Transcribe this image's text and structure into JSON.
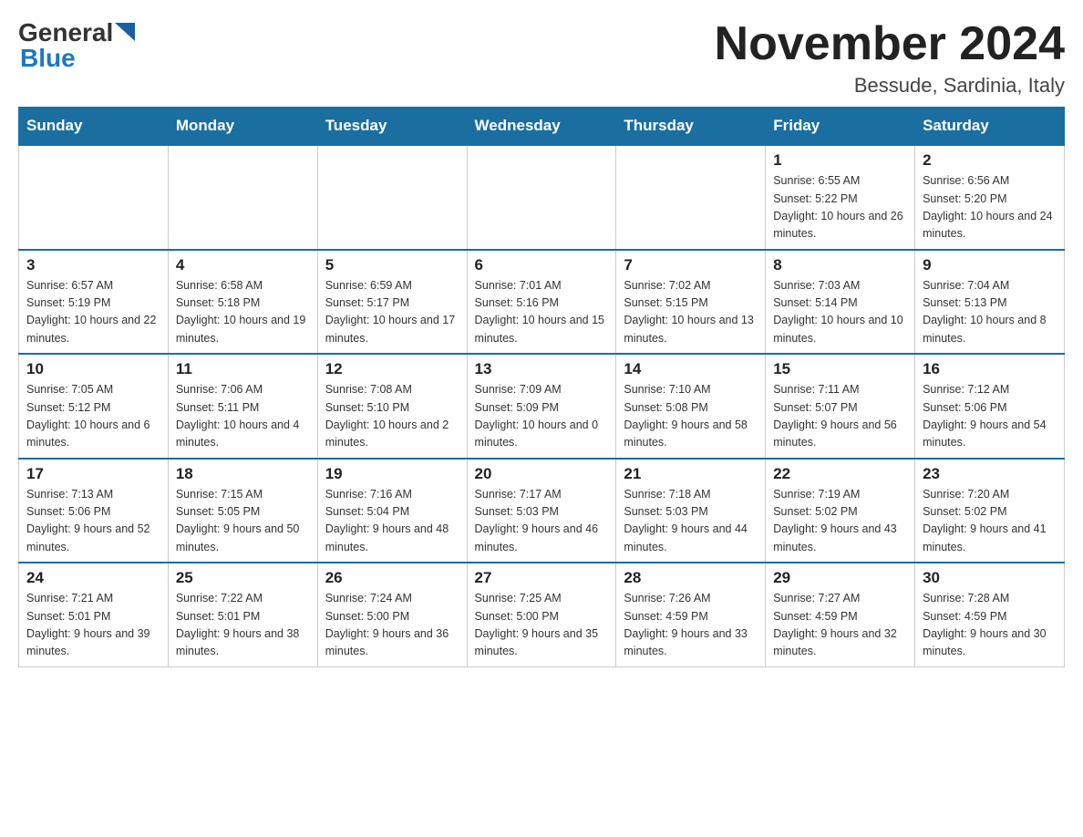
{
  "header": {
    "logo_general": "General",
    "logo_blue": "Blue",
    "title": "November 2024",
    "subtitle": "Bessude, Sardinia, Italy"
  },
  "weekdays": [
    "Sunday",
    "Monday",
    "Tuesday",
    "Wednesday",
    "Thursday",
    "Friday",
    "Saturday"
  ],
  "weeks": [
    [
      {
        "day": "",
        "info": ""
      },
      {
        "day": "",
        "info": ""
      },
      {
        "day": "",
        "info": ""
      },
      {
        "day": "",
        "info": ""
      },
      {
        "day": "",
        "info": ""
      },
      {
        "day": "1",
        "info": "Sunrise: 6:55 AM\nSunset: 5:22 PM\nDaylight: 10 hours and 26 minutes."
      },
      {
        "day": "2",
        "info": "Sunrise: 6:56 AM\nSunset: 5:20 PM\nDaylight: 10 hours and 24 minutes."
      }
    ],
    [
      {
        "day": "3",
        "info": "Sunrise: 6:57 AM\nSunset: 5:19 PM\nDaylight: 10 hours and 22 minutes."
      },
      {
        "day": "4",
        "info": "Sunrise: 6:58 AM\nSunset: 5:18 PM\nDaylight: 10 hours and 19 minutes."
      },
      {
        "day": "5",
        "info": "Sunrise: 6:59 AM\nSunset: 5:17 PM\nDaylight: 10 hours and 17 minutes."
      },
      {
        "day": "6",
        "info": "Sunrise: 7:01 AM\nSunset: 5:16 PM\nDaylight: 10 hours and 15 minutes."
      },
      {
        "day": "7",
        "info": "Sunrise: 7:02 AM\nSunset: 5:15 PM\nDaylight: 10 hours and 13 minutes."
      },
      {
        "day": "8",
        "info": "Sunrise: 7:03 AM\nSunset: 5:14 PM\nDaylight: 10 hours and 10 minutes."
      },
      {
        "day": "9",
        "info": "Sunrise: 7:04 AM\nSunset: 5:13 PM\nDaylight: 10 hours and 8 minutes."
      }
    ],
    [
      {
        "day": "10",
        "info": "Sunrise: 7:05 AM\nSunset: 5:12 PM\nDaylight: 10 hours and 6 minutes."
      },
      {
        "day": "11",
        "info": "Sunrise: 7:06 AM\nSunset: 5:11 PM\nDaylight: 10 hours and 4 minutes."
      },
      {
        "day": "12",
        "info": "Sunrise: 7:08 AM\nSunset: 5:10 PM\nDaylight: 10 hours and 2 minutes."
      },
      {
        "day": "13",
        "info": "Sunrise: 7:09 AM\nSunset: 5:09 PM\nDaylight: 10 hours and 0 minutes."
      },
      {
        "day": "14",
        "info": "Sunrise: 7:10 AM\nSunset: 5:08 PM\nDaylight: 9 hours and 58 minutes."
      },
      {
        "day": "15",
        "info": "Sunrise: 7:11 AM\nSunset: 5:07 PM\nDaylight: 9 hours and 56 minutes."
      },
      {
        "day": "16",
        "info": "Sunrise: 7:12 AM\nSunset: 5:06 PM\nDaylight: 9 hours and 54 minutes."
      }
    ],
    [
      {
        "day": "17",
        "info": "Sunrise: 7:13 AM\nSunset: 5:06 PM\nDaylight: 9 hours and 52 minutes."
      },
      {
        "day": "18",
        "info": "Sunrise: 7:15 AM\nSunset: 5:05 PM\nDaylight: 9 hours and 50 minutes."
      },
      {
        "day": "19",
        "info": "Sunrise: 7:16 AM\nSunset: 5:04 PM\nDaylight: 9 hours and 48 minutes."
      },
      {
        "day": "20",
        "info": "Sunrise: 7:17 AM\nSunset: 5:03 PM\nDaylight: 9 hours and 46 minutes."
      },
      {
        "day": "21",
        "info": "Sunrise: 7:18 AM\nSunset: 5:03 PM\nDaylight: 9 hours and 44 minutes."
      },
      {
        "day": "22",
        "info": "Sunrise: 7:19 AM\nSunset: 5:02 PM\nDaylight: 9 hours and 43 minutes."
      },
      {
        "day": "23",
        "info": "Sunrise: 7:20 AM\nSunset: 5:02 PM\nDaylight: 9 hours and 41 minutes."
      }
    ],
    [
      {
        "day": "24",
        "info": "Sunrise: 7:21 AM\nSunset: 5:01 PM\nDaylight: 9 hours and 39 minutes."
      },
      {
        "day": "25",
        "info": "Sunrise: 7:22 AM\nSunset: 5:01 PM\nDaylight: 9 hours and 38 minutes."
      },
      {
        "day": "26",
        "info": "Sunrise: 7:24 AM\nSunset: 5:00 PM\nDaylight: 9 hours and 36 minutes."
      },
      {
        "day": "27",
        "info": "Sunrise: 7:25 AM\nSunset: 5:00 PM\nDaylight: 9 hours and 35 minutes."
      },
      {
        "day": "28",
        "info": "Sunrise: 7:26 AM\nSunset: 4:59 PM\nDaylight: 9 hours and 33 minutes."
      },
      {
        "day": "29",
        "info": "Sunrise: 7:27 AM\nSunset: 4:59 PM\nDaylight: 9 hours and 32 minutes."
      },
      {
        "day": "30",
        "info": "Sunrise: 7:28 AM\nSunset: 4:59 PM\nDaylight: 9 hours and 30 minutes."
      }
    ]
  ]
}
